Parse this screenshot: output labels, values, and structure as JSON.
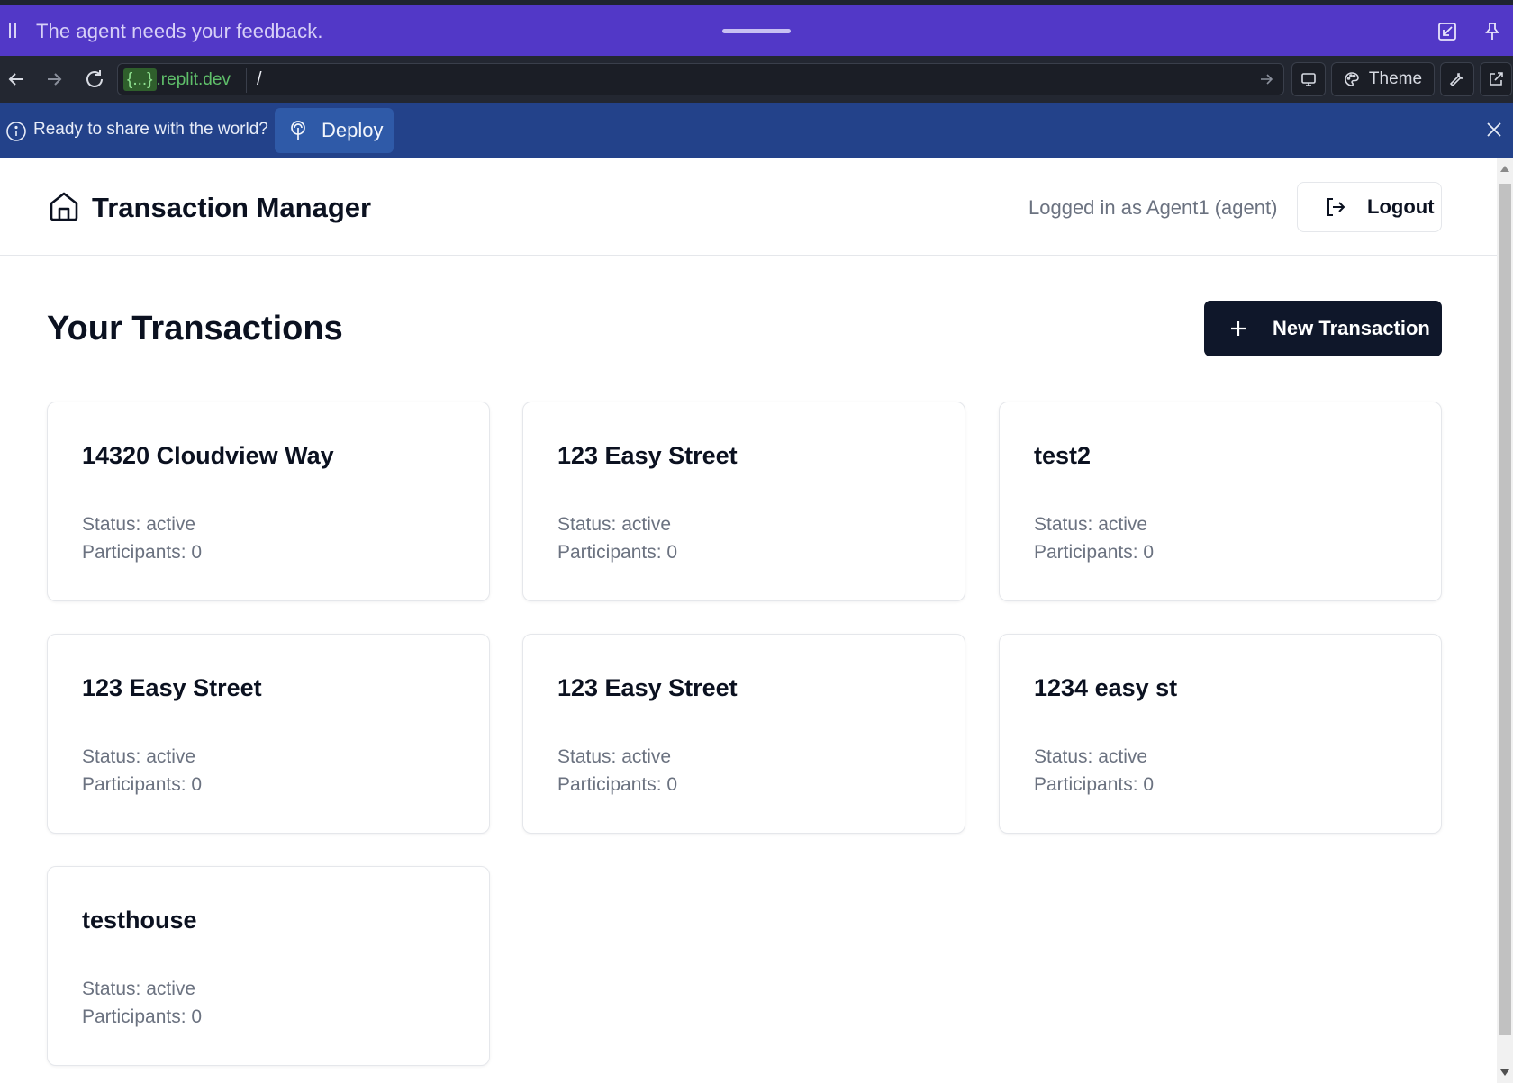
{
  "agent_bar": {
    "message": "The agent needs your feedback.",
    "icons": [
      "pause-icon",
      "drag-handle",
      "minimize-icon",
      "pin-icon"
    ]
  },
  "browser": {
    "url_host_braces": "{...}",
    "url_host_domain": ".replit.dev",
    "url_path": "/",
    "theme_label": "Theme",
    "icons": [
      "back-arrow-icon",
      "forward-arrow-icon",
      "reload-icon",
      "go-arrow-icon",
      "monitor-icon",
      "palette-icon",
      "wrench-icon",
      "external-link-icon"
    ]
  },
  "deploy_banner": {
    "message": "Ready to share with the world?",
    "button_label": "Deploy"
  },
  "header": {
    "title": "Transaction Manager",
    "login_text": "Logged in as Agent1 (agent)",
    "logout_label": "Logout"
  },
  "main": {
    "title": "Your Transactions",
    "new_button_label": "New Transaction",
    "transactions": [
      {
        "name": "14320 Cloudview Way",
        "status": "Status: active",
        "participants": "Participants: 0"
      },
      {
        "name": "123 Easy Street",
        "status": "Status: active",
        "participants": "Participants: 0"
      },
      {
        "name": "test2",
        "status": "Status: active",
        "participants": "Participants: 0"
      },
      {
        "name": "123 Easy Street",
        "status": "Status: active",
        "participants": "Participants: 0"
      },
      {
        "name": "123 Easy Street",
        "status": "Status: active",
        "participants": "Participants: 0"
      },
      {
        "name": "1234 easy st",
        "status": "Status: active",
        "participants": "Participants: 0"
      },
      {
        "name": "testhouse",
        "status": "Status: active",
        "participants": "Participants: 0"
      }
    ]
  },
  "colors": {
    "agent_bar": "#5238c7",
    "url_bar": "#232731",
    "deploy_banner": "#23428a",
    "primary_button": "#0f172a"
  }
}
